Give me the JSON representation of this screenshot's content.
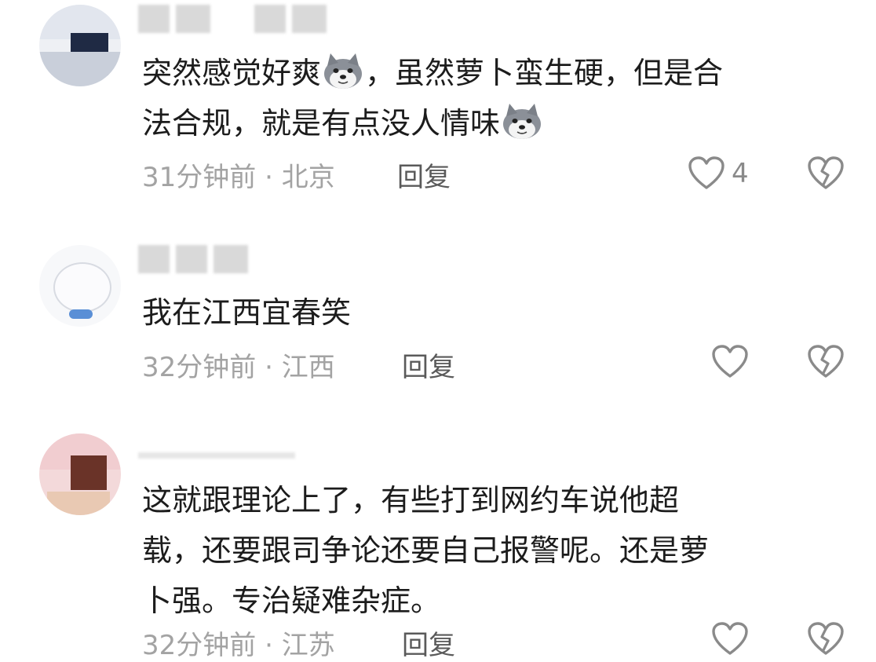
{
  "comments": [
    {
      "text_line1": "突然感觉好爽",
      "text_line1b": "，虽然萝卜蛮生硬，但是合",
      "text_line2": "法合规，就是有点没人情味",
      "time": "31分钟前",
      "location": "北京",
      "reply_label": "回复",
      "like_count": "4"
    },
    {
      "text_line1": "我在江西宜春笑",
      "time": "32分钟前",
      "location": "江西",
      "reply_label": "回复"
    },
    {
      "text_line1": "这就跟理论上了，有些打到网约车说他超",
      "text_line2": "载，还要跟司争论还要自己报警呢。还是萝",
      "text_line3": "卜强。专治疑难杂症。",
      "time": "32分钟前",
      "location": "江苏",
      "reply_label": "回复"
    }
  ],
  "icons": {
    "emoji": "husky-face-emoji",
    "like": "heart-outline-icon",
    "dislike": "broken-heart-icon"
  },
  "colors": {
    "text": "#1c1c1c",
    "meta": "#a3a3a3",
    "reply": "#5a5a5a",
    "icon": "#8a8a8a"
  }
}
